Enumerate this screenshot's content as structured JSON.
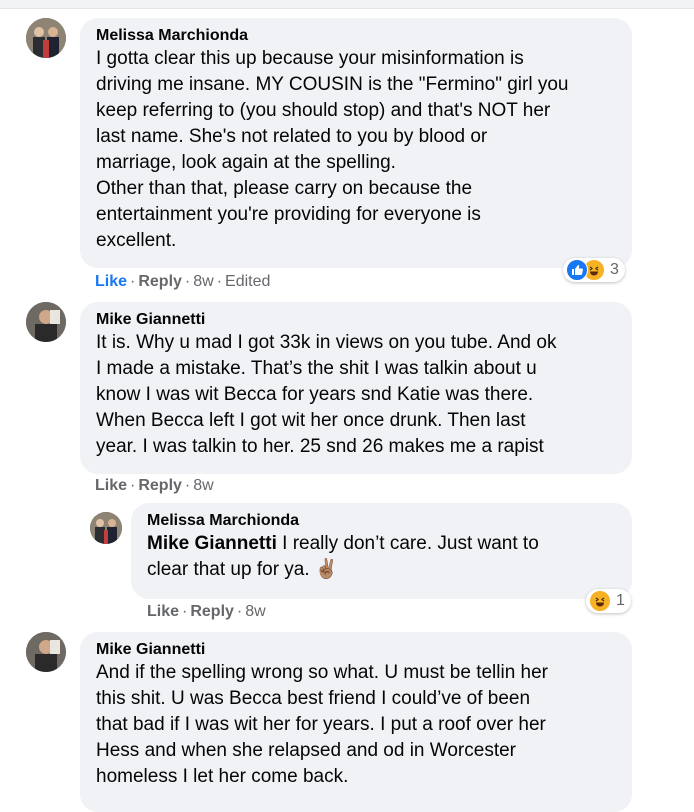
{
  "comments": [
    {
      "author": "Melissa Marchionda",
      "text": "I gotta clear this up because your misinformation is\ndriving me insane. MY COUSIN is the \"Fermino\" girl you\nkeep referring to (you should stop) and that's NOT her\nlast name. She's not related to you by blood or\nmarriage, look again at the spelling.\nOther than that, please carry on because the\nentertainment you're providing for everyone is\nexcellent.",
      "actions": {
        "like": "Like",
        "reply": "Reply",
        "time": "8w",
        "edited": "Edited"
      },
      "reaction_count": "3",
      "reaction_icons": [
        "like-icon",
        "haha-icon"
      ]
    },
    {
      "author": "Mike Giannetti",
      "text": "It is. Why u mad I got 33k in views on you tube. And ok\nI made a mistake. That’s the shit I was talkin about u\nknow I was wit Becca for years snd Katie was there.\nWhen Becca left I got wit her once drunk. Then last\nyear. I was talkin to her. 25 snd 26 makes me a rapist",
      "actions": {
        "like": "Like",
        "reply": "Reply",
        "time": "8w"
      }
    },
    {
      "author": "Melissa Marchionda",
      "mention": "Mike Giannetti",
      "text": " I really don’t care. Just want to\nclear that up for ya. ✌🏽",
      "actions": {
        "like": "Like",
        "reply": "Reply",
        "time": "8w"
      },
      "reaction_count": "1",
      "reaction_icons": [
        "haha-icon"
      ]
    },
    {
      "author": "Mike Giannetti",
      "text": "And if the spelling wrong so what. U must be tellin her\nthis shit. U was Becca best friend I could’ve of been\nthat bad if I was wit her for years. I put a roof over her\nHess and when she relapsed and od in Worcester\nhomeless I let her come back."
    }
  ],
  "separator": "·",
  "colors": {
    "bubble": "#f0f2f5",
    "meta": "#65676b",
    "like_active": "#1877f2",
    "haha": "#f7b125"
  }
}
